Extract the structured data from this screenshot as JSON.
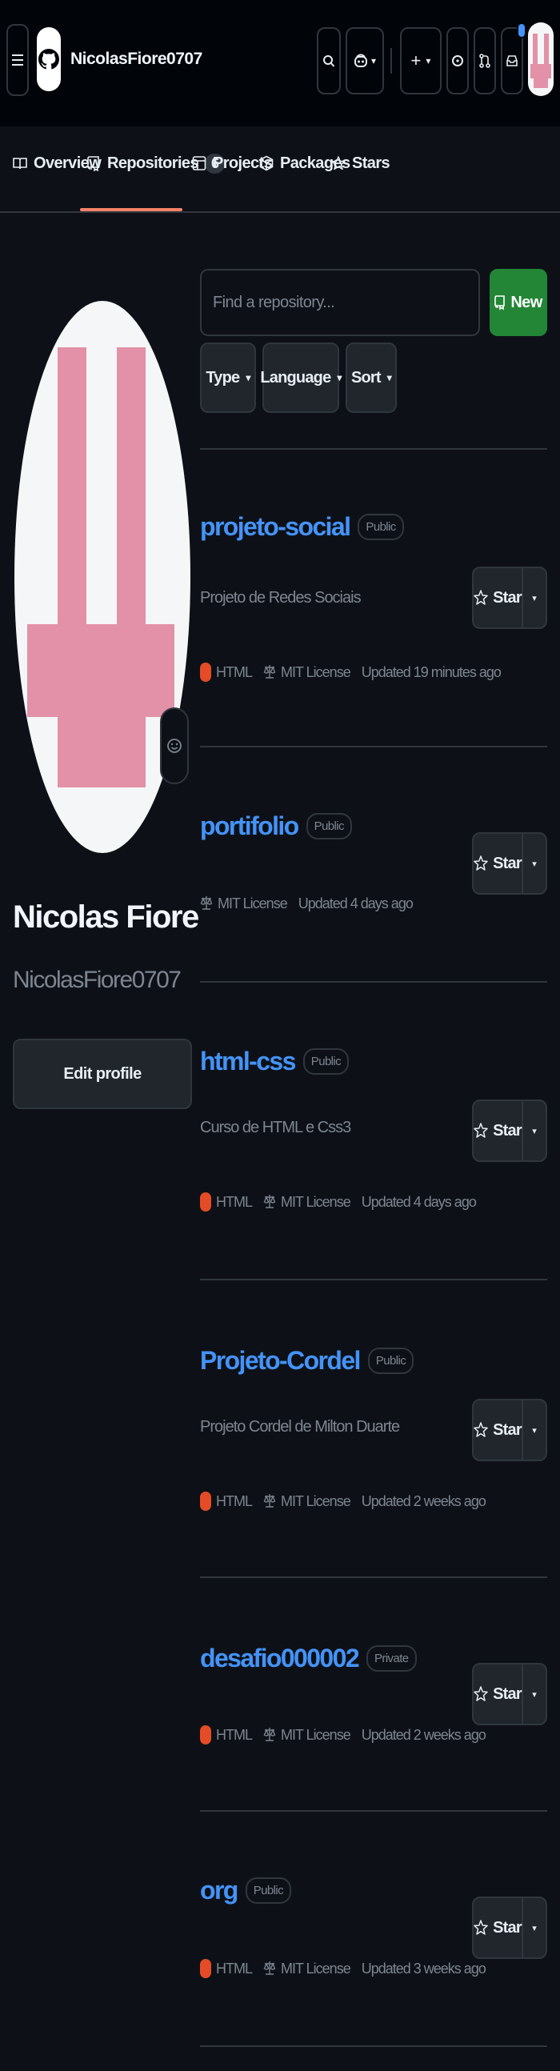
{
  "header": {
    "username": "NicolasFiore0707"
  },
  "tabs": [
    {
      "label": "Overview"
    },
    {
      "label": "Repositories",
      "count": "6"
    },
    {
      "label": "Projects"
    },
    {
      "label": "Packages"
    },
    {
      "label": "Stars"
    }
  ],
  "profile": {
    "full_name": "Nicolas Fiore",
    "login": "NicolasFiore0707",
    "edit_label": "Edit profile"
  },
  "search": {
    "placeholder": "Find a repository..."
  },
  "new_label": "New",
  "filters": [
    "Type",
    "Language",
    "Sort"
  ],
  "star_label": "Star",
  "repos": [
    {
      "name": "projeto-social",
      "visibility": "Public",
      "description": "Projeto de Redes Sociais",
      "language": "HTML",
      "license": "MIT License",
      "updated": "Updated 19 minutes ago"
    },
    {
      "name": "portifolio",
      "visibility": "Public",
      "description": "",
      "language": "",
      "license": "MIT License",
      "updated": "Updated 4 days ago"
    },
    {
      "name": "html-css",
      "visibility": "Public",
      "description": "Curso de HTML e Css3",
      "language": "HTML",
      "license": "MIT License",
      "updated": "Updated 4 days ago"
    },
    {
      "name": "Projeto-Cordel",
      "visibility": "Public",
      "description": "Projeto Cordel de Milton Duarte",
      "language": "HTML",
      "license": "MIT License",
      "updated": "Updated 2 weeks ago"
    },
    {
      "name": "desafio000002",
      "visibility": "Private",
      "description": "",
      "language": "HTML",
      "license": "MIT License",
      "updated": "Updated 2 weeks ago"
    },
    {
      "name": "org",
      "visibility": "Public",
      "description": "",
      "language": "HTML",
      "license": "MIT License",
      "updated": "Updated 3 weeks ago"
    }
  ],
  "colors": {
    "accent": "#4493f8",
    "new_button": "#238636",
    "html_lang": "#e34c26",
    "tab_underline": "#f78166",
    "avatar_pink": "#e291a8"
  }
}
